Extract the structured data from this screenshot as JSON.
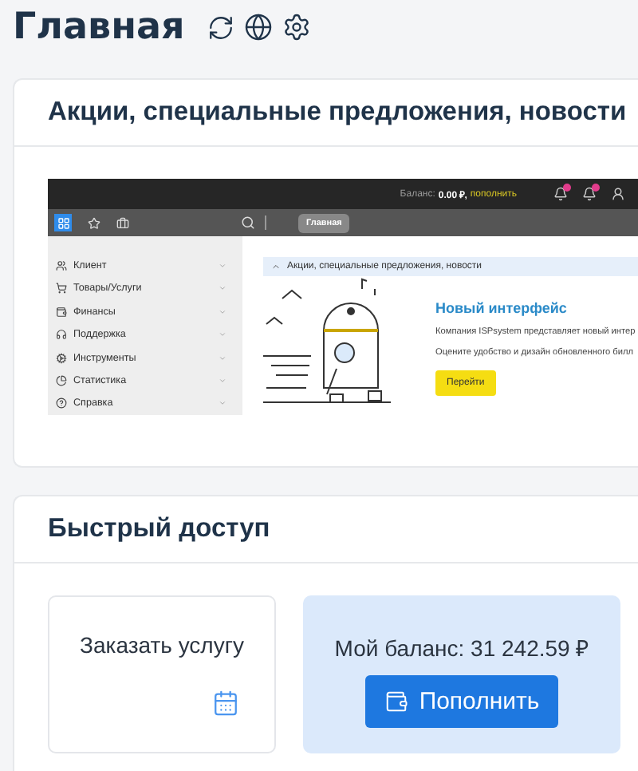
{
  "page": {
    "title": "Главная"
  },
  "news_card": {
    "title": "Акции, специальные предложения, новости",
    "preview": {
      "topbar": {
        "balance_label": "Баланс:",
        "balance_value": "0.00 ₽,",
        "topup_link": "пополнить"
      },
      "tab": "Главная",
      "menu": [
        {
          "label": "Клиент"
        },
        {
          "label": "Товары/Услуги"
        },
        {
          "label": "Финансы"
        },
        {
          "label": "Поддержка"
        },
        {
          "label": "Инструменты"
        },
        {
          "label": "Статистика"
        },
        {
          "label": "Справка"
        }
      ],
      "section_title": "Акции, специальные предложения, новости",
      "headline": "Новый интерфейс",
      "lines": [
        "Компания ISPsystem представляет новый интер",
        "Оцените удобство и дизайн обновленного билл"
      ],
      "button": "Перейти"
    }
  },
  "quick_access": {
    "title": "Быстрый доступ",
    "tiles": [
      {
        "kind": "link",
        "label": "Заказать услугу"
      },
      {
        "kind": "balance",
        "label": "Мой баланс: 31 242.59 ₽",
        "button": "Пополнить"
      }
    ]
  }
}
